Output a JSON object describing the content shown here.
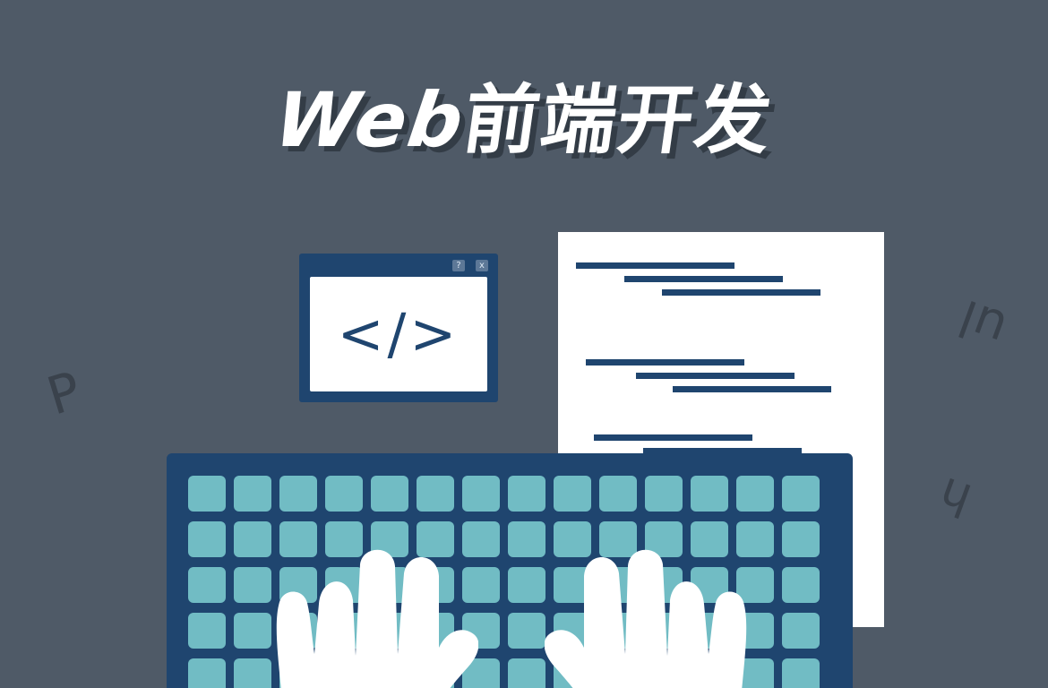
{
  "title": {
    "latin": "Web",
    "chinese": "前端开发"
  },
  "floating_letters": {
    "p": "P",
    "ul": "ul",
    "h": "h"
  },
  "code_window": {
    "help_button": "?",
    "close_button": "x",
    "code_symbol": "</>"
  },
  "icons": {
    "code_window": "code-window-icon",
    "document": "document-icon",
    "keyboard": "keyboard-icon",
    "left_hand": "left-hand-icon",
    "right_hand": "right-hand-icon"
  },
  "colors": {
    "background": "#4f5a67",
    "navy": "#1f456f",
    "teal": "#71bcc4",
    "white": "#ffffff",
    "shadow": "#39414b"
  }
}
